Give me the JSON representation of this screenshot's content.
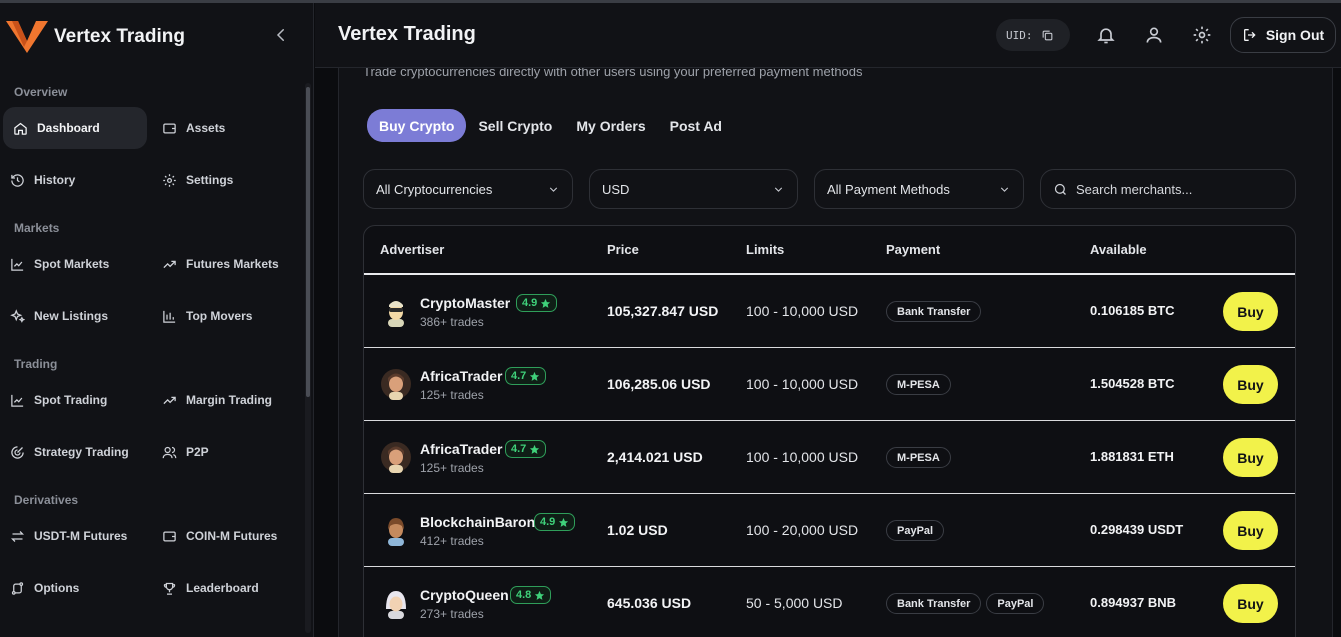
{
  "app": {
    "name": "Vertex Trading"
  },
  "colors": {
    "accent": "#7c7cd6",
    "buy": "#f2f24a",
    "rating": "#3fd17a",
    "logo": "#f0762f"
  },
  "sidebar": {
    "sections": [
      {
        "label": "Overview",
        "items": [
          {
            "label": "Dashboard",
            "icon": "home-icon",
            "active": true
          },
          {
            "label": "Assets",
            "icon": "wallet-icon"
          },
          {
            "label": "History",
            "icon": "history-icon"
          },
          {
            "label": "Settings",
            "icon": "gear-icon"
          }
        ]
      },
      {
        "label": "Markets",
        "items": [
          {
            "label": "Spot Markets",
            "icon": "chart-line-icon"
          },
          {
            "label": "Futures Markets",
            "icon": "trending-up-icon"
          },
          {
            "label": "New Listings",
            "icon": "sparkles-icon"
          },
          {
            "label": "Top Movers",
            "icon": "bar-chart-icon"
          }
        ]
      },
      {
        "label": "Trading",
        "items": [
          {
            "label": "Spot Trading",
            "icon": "chart-line-icon"
          },
          {
            "label": "Margin Trading",
            "icon": "trending-up-icon"
          },
          {
            "label": "Strategy Trading",
            "icon": "strategy-icon"
          },
          {
            "label": "P2P",
            "icon": "users-icon"
          }
        ]
      },
      {
        "label": "Derivatives",
        "items": [
          {
            "label": "USDT-M Futures",
            "icon": "arrows-icon"
          },
          {
            "label": "COIN-M Futures",
            "icon": "wallet-icon"
          },
          {
            "label": "Options",
            "icon": "options-icon"
          },
          {
            "label": "Leaderboard",
            "icon": "trophy-icon"
          }
        ]
      }
    ]
  },
  "header": {
    "title": "Vertex Trading",
    "uid_label": "UID:",
    "signout_label": "Sign Out"
  },
  "main": {
    "subtitle": "Trade cryptocurrencies directly with other users using your preferred payment methods",
    "tabs": [
      {
        "label": "Buy Crypto",
        "active": true
      },
      {
        "label": "Sell Crypto"
      },
      {
        "label": "My Orders"
      },
      {
        "label": "Post Ad"
      }
    ],
    "filters": {
      "crypto": "All Cryptocurrencies",
      "currency": "USD",
      "payment": "All Payment Methods"
    },
    "search": {
      "placeholder": "Search merchants..."
    },
    "table": {
      "headers": [
        "Advertiser",
        "Price",
        "Limits",
        "Payment",
        "Available"
      ],
      "buy_label": "Buy",
      "rows": [
        {
          "name": "CryptoMaster",
          "rating": "4.9",
          "trades": "386+ trades",
          "price": "105,327.847 USD",
          "limits": "100 - 10,000 USD",
          "payments": [
            "Bank Transfer"
          ],
          "available": "0.106185 BTC"
        },
        {
          "name": "AfricaTrader",
          "rating": "4.7",
          "trades": "125+ trades",
          "price": "106,285.06 USD",
          "limits": "100 - 10,000 USD",
          "payments": [
            "M-PESA"
          ],
          "available": "1.504528 BTC"
        },
        {
          "name": "AfricaTrader",
          "rating": "4.7",
          "trades": "125+ trades",
          "price": "2,414.021 USD",
          "limits": "100 - 10,000 USD",
          "payments": [
            "M-PESA"
          ],
          "available": "1.881831 ETH"
        },
        {
          "name": "BlockchainBaron",
          "rating": "4.9",
          "trades": "412+ trades",
          "price": "1.02 USD",
          "limits": "100 - 20,000 USD",
          "payments": [
            "PayPal"
          ],
          "available": "0.298439 USDT"
        },
        {
          "name": "CryptoQueen",
          "rating": "4.8",
          "trades": "273+ trades",
          "price": "645.036 USD",
          "limits": "50 - 5,000 USD",
          "payments": [
            "Bank Transfer",
            "PayPal"
          ],
          "available": "0.894937 BNB"
        }
      ]
    }
  }
}
